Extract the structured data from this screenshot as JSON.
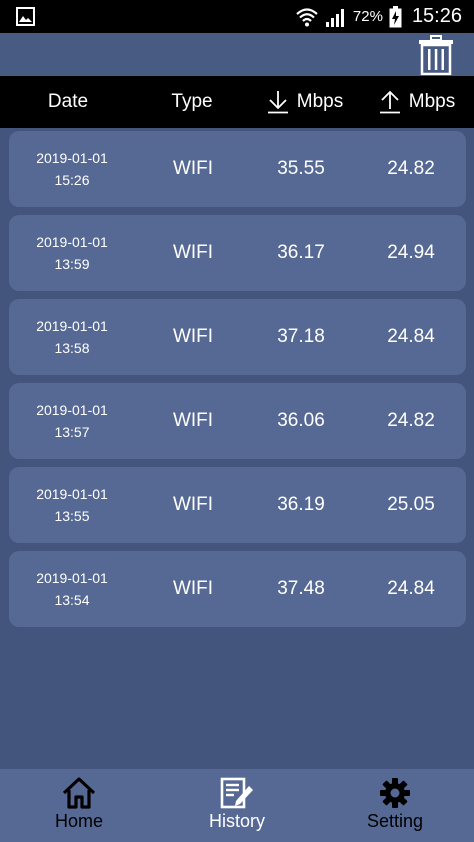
{
  "status_bar": {
    "battery_percent": "72%",
    "time": "15:26"
  },
  "columns": {
    "date": "Date",
    "type": "Type",
    "download": "Mbps",
    "upload": "Mbps"
  },
  "rows": [
    {
      "date": "2019-01-01",
      "time": "15:26",
      "type": "WIFI",
      "download": "35.55",
      "upload": "24.82"
    },
    {
      "date": "2019-01-01",
      "time": "13:59",
      "type": "WIFI",
      "download": "36.17",
      "upload": "24.94"
    },
    {
      "date": "2019-01-01",
      "time": "13:58",
      "type": "WIFI",
      "download": "37.18",
      "upload": "24.84"
    },
    {
      "date": "2019-01-01",
      "time": "13:57",
      "type": "WIFI",
      "download": "36.06",
      "upload": "24.82"
    },
    {
      "date": "2019-01-01",
      "time": "13:55",
      "type": "WIFI",
      "download": "36.19",
      "upload": "25.05"
    },
    {
      "date": "2019-01-01",
      "time": "13:54",
      "type": "WIFI",
      "download": "37.48",
      "upload": "24.84"
    }
  ],
  "nav": {
    "home": "Home",
    "history": "History",
    "setting": "Setting",
    "active": "history"
  },
  "colors": {
    "background": "#43557c",
    "row": "#566994",
    "header": "#000000",
    "nav_bar": "#566994"
  }
}
